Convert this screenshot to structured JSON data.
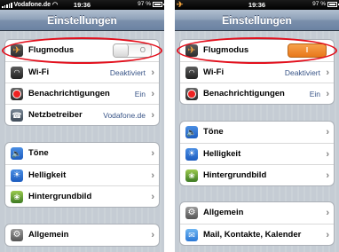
{
  "left_screen": {
    "status": {
      "carrier": "Vodafone.de",
      "time": "19:36",
      "battery": "97 %"
    },
    "title": "Einstellungen",
    "group1": [
      {
        "label": "Flugmodus",
        "icon": "airplane-icon",
        "toggle": "off",
        "toggle_mark": "O"
      },
      {
        "label": "Wi-Fi",
        "value": "Deaktiviert",
        "icon": "wifi-icon"
      },
      {
        "label": "Benachrichtigungen",
        "value": "Ein",
        "icon": "notifications-icon"
      },
      {
        "label": "Netzbetreiber",
        "value": "Vodafone.de",
        "icon": "carrier-icon"
      }
    ],
    "group2": [
      {
        "label": "Töne",
        "icon": "speaker-icon"
      },
      {
        "label": "Helligkeit",
        "icon": "brightness-icon"
      },
      {
        "label": "Hintergrundbild",
        "icon": "wallpaper-icon"
      }
    ],
    "group3": [
      {
        "label": "Allgemein",
        "icon": "gear-icon"
      }
    ]
  },
  "right_screen": {
    "status": {
      "time": "19:36",
      "battery": "97 %"
    },
    "title": "Einstellungen",
    "group1": [
      {
        "label": "Flugmodus",
        "icon": "airplane-icon",
        "toggle": "on",
        "toggle_mark": "I"
      },
      {
        "label": "Wi-Fi",
        "value": "Deaktiviert",
        "icon": "wifi-icon"
      },
      {
        "label": "Benachrichtigungen",
        "value": "Ein",
        "icon": "notifications-icon"
      }
    ],
    "group2": [
      {
        "label": "Töne",
        "icon": "speaker-icon"
      },
      {
        "label": "Helligkeit",
        "icon": "brightness-icon"
      },
      {
        "label": "Hintergrundbild",
        "icon": "wallpaper-icon"
      }
    ],
    "group3": [
      {
        "label": "Allgemein",
        "icon": "gear-icon"
      },
      {
        "label": "Mail, Kontakte, Kalender",
        "icon": "mail-icon"
      }
    ]
  },
  "colors": {
    "highlight": "#e30f1c",
    "toggle_on": "#f08a2e",
    "value_text": "#385487",
    "nav_bar": "#7b90ac"
  }
}
